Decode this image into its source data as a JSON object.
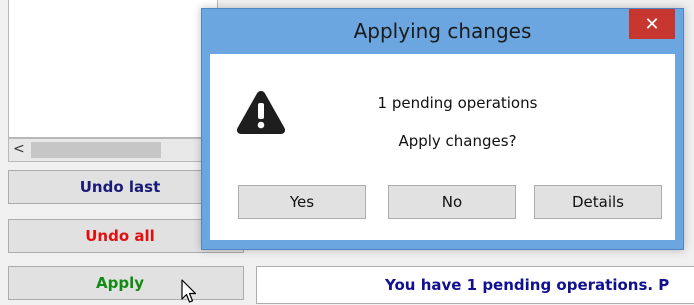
{
  "dialog": {
    "title": "Applying changes",
    "close_glyph": "✕",
    "message_line1": "1 pending operations",
    "message_line2": "Apply changes?",
    "buttons": {
      "yes": "Yes",
      "no": "No",
      "details": "Details"
    },
    "icon": "warning-icon"
  },
  "main": {
    "scroll_left_glyph": "<",
    "buttons": {
      "undo_last": "Undo last",
      "undo_all": "Undo all",
      "apply": "Apply"
    },
    "status": "You have 1 pending operations. P"
  },
  "colors": {
    "dialog_frame": "#6ba6e0",
    "close_button": "#c7372f",
    "undo_last_text": "#1a1a7a",
    "undo_all_text": "#e01010",
    "apply_text": "#138a13",
    "status_text": "#101090"
  }
}
